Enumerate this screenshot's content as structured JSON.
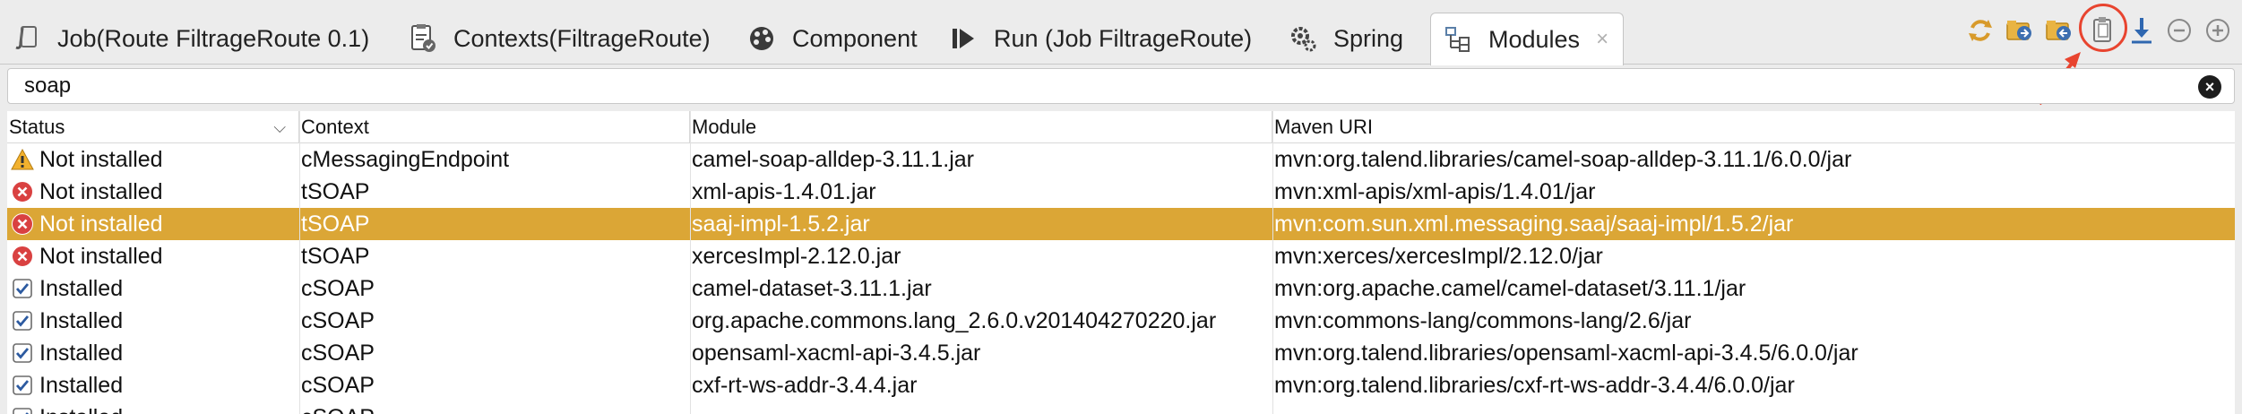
{
  "tabs": [
    {
      "label": "Job(Route FiltrageRoute 0.1)",
      "icon": "job-icon"
    },
    {
      "label": "Contexts(FiltrageRoute)",
      "icon": "contexts-icon"
    },
    {
      "label": "Component",
      "icon": "component-icon"
    },
    {
      "label": "Run (Job FiltrageRoute)",
      "icon": "run-icon"
    },
    {
      "label": "Spring",
      "icon": "spring-icon"
    },
    {
      "label": "Modules",
      "icon": "modules-icon",
      "active": true
    }
  ],
  "tab_close": "×",
  "toolbar": [
    "refresh-icon",
    "import-icon",
    "export-icon",
    "copy-icon",
    "download-icon",
    "collapse-icon",
    "expand-icon"
  ],
  "search": {
    "value": "soap",
    "clear": "×"
  },
  "columns": {
    "status": "Status",
    "context": "Context",
    "module": "Module",
    "maven": "Maven URI"
  },
  "rows": [
    {
      "status_icon": "warning-icon",
      "status": "Not installed",
      "context": "cMessagingEndpoint",
      "module": "camel-soap-alldep-3.11.1.jar",
      "maven": "mvn:org.talend.libraries/camel-soap-alldep-3.11.1/6.0.0/jar"
    },
    {
      "status_icon": "error-icon",
      "status": "Not installed",
      "context": "tSOAP",
      "module": "xml-apis-1.4.01.jar",
      "maven": "mvn:xml-apis/xml-apis/1.4.01/jar"
    },
    {
      "status_icon": "error-icon",
      "status": "Not installed",
      "context": "tSOAP",
      "module": "saaj-impl-1.5.2.jar",
      "maven": "mvn:com.sun.xml.messaging.saaj/saaj-impl/1.5.2/jar",
      "selected": true
    },
    {
      "status_icon": "error-icon",
      "status": "Not installed",
      "context": "tSOAP",
      "module": "xercesImpl-2.12.0.jar",
      "maven": "mvn:xerces/xercesImpl/2.12.0/jar"
    },
    {
      "status_icon": "check-icon",
      "status": "Installed",
      "context": "cSOAP",
      "module": "camel-dataset-3.11.1.jar",
      "maven": "mvn:org.apache.camel/camel-dataset/3.11.1/jar"
    },
    {
      "status_icon": "check-icon",
      "status": "Installed",
      "context": "cSOAP",
      "module": "org.apache.commons.lang_2.6.0.v201404270220.jar",
      "maven": "mvn:commons-lang/commons-lang/2.6/jar"
    },
    {
      "status_icon": "check-icon",
      "status": "Installed",
      "context": "cSOAP",
      "module": "opensaml-xacml-api-3.4.5.jar",
      "maven": "mvn:org.talend.libraries/opensaml-xacml-api-3.4.5/6.0.0/jar"
    },
    {
      "status_icon": "check-icon",
      "status": "Installed",
      "context": "cSOAP",
      "module": "cxf-rt-ws-addr-3.4.4.jar",
      "maven": "mvn:org.talend.libraries/cxf-rt-ws-addr-3.4.4/6.0.0/jar"
    },
    {
      "status_icon": "check-icon",
      "status": "Installed",
      "context": "cSOAP",
      "module": "",
      "maven": ""
    }
  ],
  "colors": {
    "selected": "#dba636",
    "warning": "#f2b12e",
    "error": "#d94141",
    "annotation": "#e8442f"
  }
}
